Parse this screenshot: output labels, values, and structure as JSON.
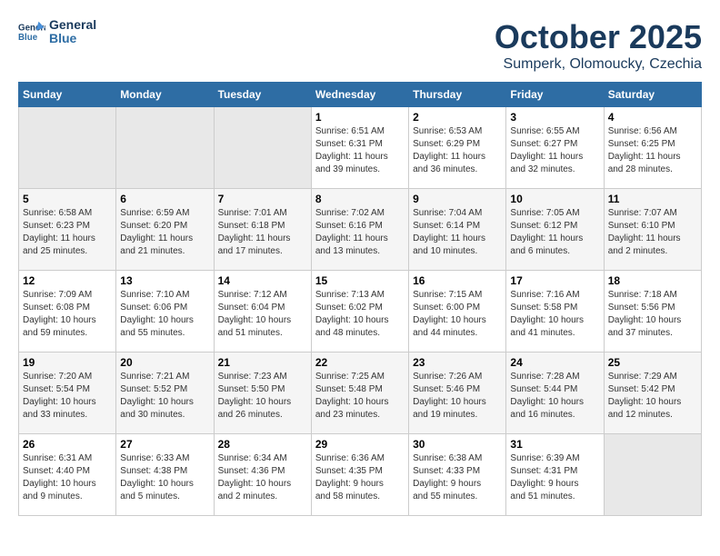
{
  "header": {
    "logo_line1": "General",
    "logo_line2": "Blue",
    "month": "October 2025",
    "location": "Sumperk, Olomoucky, Czechia"
  },
  "days_of_week": [
    "Sunday",
    "Monday",
    "Tuesday",
    "Wednesday",
    "Thursday",
    "Friday",
    "Saturday"
  ],
  "weeks": [
    [
      {
        "day": "",
        "content": ""
      },
      {
        "day": "",
        "content": ""
      },
      {
        "day": "",
        "content": ""
      },
      {
        "day": "1",
        "content": "Sunrise: 6:51 AM\nSunset: 6:31 PM\nDaylight: 11 hours\nand 39 minutes."
      },
      {
        "day": "2",
        "content": "Sunrise: 6:53 AM\nSunset: 6:29 PM\nDaylight: 11 hours\nand 36 minutes."
      },
      {
        "day": "3",
        "content": "Sunrise: 6:55 AM\nSunset: 6:27 PM\nDaylight: 11 hours\nand 32 minutes."
      },
      {
        "day": "4",
        "content": "Sunrise: 6:56 AM\nSunset: 6:25 PM\nDaylight: 11 hours\nand 28 minutes."
      }
    ],
    [
      {
        "day": "5",
        "content": "Sunrise: 6:58 AM\nSunset: 6:23 PM\nDaylight: 11 hours\nand 25 minutes."
      },
      {
        "day": "6",
        "content": "Sunrise: 6:59 AM\nSunset: 6:20 PM\nDaylight: 11 hours\nand 21 minutes."
      },
      {
        "day": "7",
        "content": "Sunrise: 7:01 AM\nSunset: 6:18 PM\nDaylight: 11 hours\nand 17 minutes."
      },
      {
        "day": "8",
        "content": "Sunrise: 7:02 AM\nSunset: 6:16 PM\nDaylight: 11 hours\nand 13 minutes."
      },
      {
        "day": "9",
        "content": "Sunrise: 7:04 AM\nSunset: 6:14 PM\nDaylight: 11 hours\nand 10 minutes."
      },
      {
        "day": "10",
        "content": "Sunrise: 7:05 AM\nSunset: 6:12 PM\nDaylight: 11 hours\nand 6 minutes."
      },
      {
        "day": "11",
        "content": "Sunrise: 7:07 AM\nSunset: 6:10 PM\nDaylight: 11 hours\nand 2 minutes."
      }
    ],
    [
      {
        "day": "12",
        "content": "Sunrise: 7:09 AM\nSunset: 6:08 PM\nDaylight: 10 hours\nand 59 minutes."
      },
      {
        "day": "13",
        "content": "Sunrise: 7:10 AM\nSunset: 6:06 PM\nDaylight: 10 hours\nand 55 minutes."
      },
      {
        "day": "14",
        "content": "Sunrise: 7:12 AM\nSunset: 6:04 PM\nDaylight: 10 hours\nand 51 minutes."
      },
      {
        "day": "15",
        "content": "Sunrise: 7:13 AM\nSunset: 6:02 PM\nDaylight: 10 hours\nand 48 minutes."
      },
      {
        "day": "16",
        "content": "Sunrise: 7:15 AM\nSunset: 6:00 PM\nDaylight: 10 hours\nand 44 minutes."
      },
      {
        "day": "17",
        "content": "Sunrise: 7:16 AM\nSunset: 5:58 PM\nDaylight: 10 hours\nand 41 minutes."
      },
      {
        "day": "18",
        "content": "Sunrise: 7:18 AM\nSunset: 5:56 PM\nDaylight: 10 hours\nand 37 minutes."
      }
    ],
    [
      {
        "day": "19",
        "content": "Sunrise: 7:20 AM\nSunset: 5:54 PM\nDaylight: 10 hours\nand 33 minutes."
      },
      {
        "day": "20",
        "content": "Sunrise: 7:21 AM\nSunset: 5:52 PM\nDaylight: 10 hours\nand 30 minutes."
      },
      {
        "day": "21",
        "content": "Sunrise: 7:23 AM\nSunset: 5:50 PM\nDaylight: 10 hours\nand 26 minutes."
      },
      {
        "day": "22",
        "content": "Sunrise: 7:25 AM\nSunset: 5:48 PM\nDaylight: 10 hours\nand 23 minutes."
      },
      {
        "day": "23",
        "content": "Sunrise: 7:26 AM\nSunset: 5:46 PM\nDaylight: 10 hours\nand 19 minutes."
      },
      {
        "day": "24",
        "content": "Sunrise: 7:28 AM\nSunset: 5:44 PM\nDaylight: 10 hours\nand 16 minutes."
      },
      {
        "day": "25",
        "content": "Sunrise: 7:29 AM\nSunset: 5:42 PM\nDaylight: 10 hours\nand 12 minutes."
      }
    ],
    [
      {
        "day": "26",
        "content": "Sunrise: 6:31 AM\nSunset: 4:40 PM\nDaylight: 10 hours\nand 9 minutes."
      },
      {
        "day": "27",
        "content": "Sunrise: 6:33 AM\nSunset: 4:38 PM\nDaylight: 10 hours\nand 5 minutes."
      },
      {
        "day": "28",
        "content": "Sunrise: 6:34 AM\nSunset: 4:36 PM\nDaylight: 10 hours\nand 2 minutes."
      },
      {
        "day": "29",
        "content": "Sunrise: 6:36 AM\nSunset: 4:35 PM\nDaylight: 9 hours\nand 58 minutes."
      },
      {
        "day": "30",
        "content": "Sunrise: 6:38 AM\nSunset: 4:33 PM\nDaylight: 9 hours\nand 55 minutes."
      },
      {
        "day": "31",
        "content": "Sunrise: 6:39 AM\nSunset: 4:31 PM\nDaylight: 9 hours\nand 51 minutes."
      },
      {
        "day": "",
        "content": ""
      }
    ]
  ]
}
